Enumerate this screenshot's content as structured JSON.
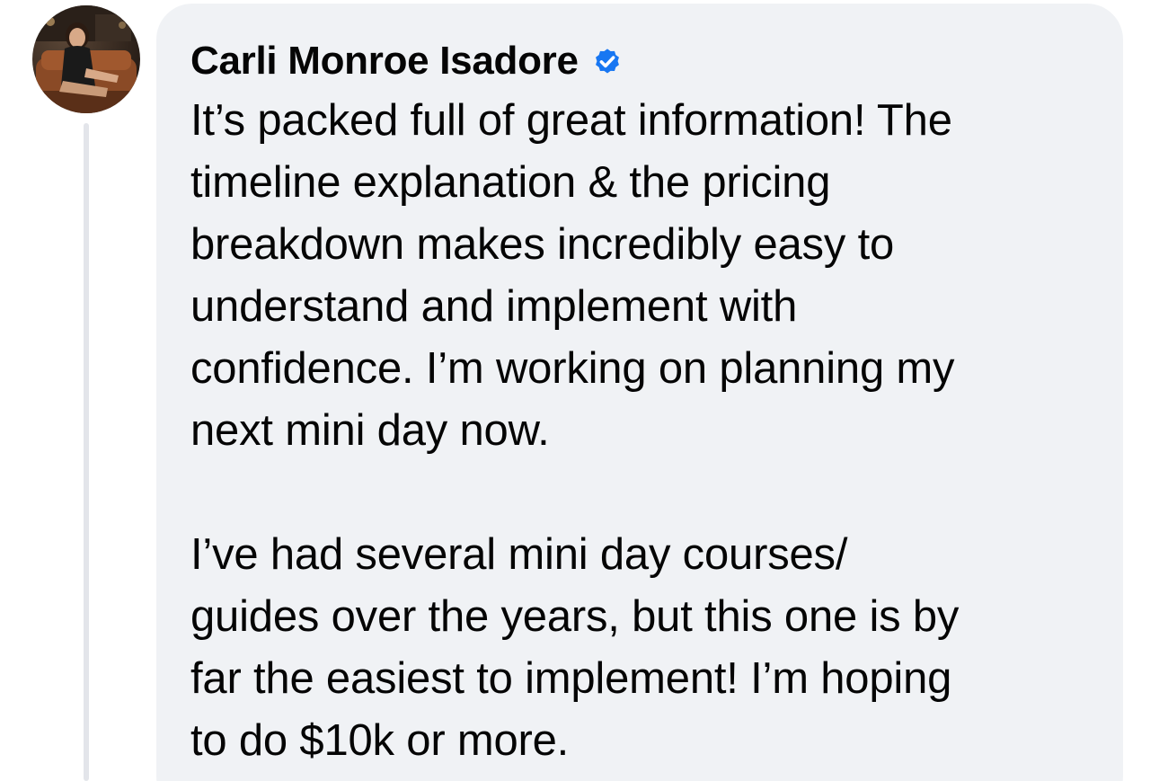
{
  "comment": {
    "author": {
      "name": "Carli Monroe Isadore",
      "verified": true,
      "avatar_icon": "profile-photo-icon",
      "verified_icon": "verified-badge-icon"
    },
    "paragraphs": [
      "It’s packed full of great information! The\ntimeline explanation & the pricing\nbreakdown makes incredibly easy to\nunderstand and implement with\nconfidence. I’m working on planning my\nnext mini day now.",
      "I’ve had several mini day courses/\nguides over the years, but this one is by\nfar the easiest to implement! I’m hoping\nto do $10k or more."
    ]
  },
  "colors": {
    "bubble_background": "#f0f2f5",
    "text": "#050505",
    "verified_badge": "#1877f2",
    "thread_line": "#e3e5ea"
  }
}
